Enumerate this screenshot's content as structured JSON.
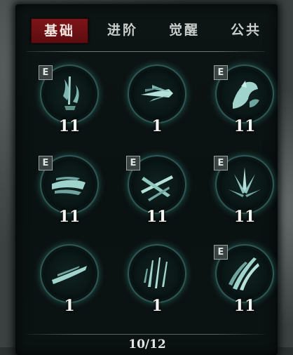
{
  "tabs": [
    {
      "label": "基础",
      "active": true
    },
    {
      "label": "进阶",
      "active": false
    },
    {
      "label": "觉醒",
      "active": false
    },
    {
      "label": "公共",
      "active": false
    }
  ],
  "skills": [
    {
      "icon": "sword-flame-icon",
      "level": "11",
      "equipped_badge": "E"
    },
    {
      "icon": "feather-arrow-icon",
      "level": "1",
      "equipped_badge": ""
    },
    {
      "icon": "shadow-strike-icon",
      "level": "11",
      "equipped_badge": "E"
    },
    {
      "icon": "slash-wave-icon",
      "level": "11",
      "equipped_badge": "E"
    },
    {
      "icon": "cross-blades-icon",
      "level": "11",
      "equipped_badge": "E"
    },
    {
      "icon": "burst-blades-icon",
      "level": "11",
      "equipped_badge": "E"
    },
    {
      "icon": "dash-slash-icon",
      "level": "1",
      "equipped_badge": ""
    },
    {
      "icon": "falling-blades-icon",
      "level": "1",
      "equipped_badge": ""
    },
    {
      "icon": "claw-rake-icon",
      "level": "11",
      "equipped_badge": "E"
    }
  ],
  "pager": {
    "text": "10/12"
  },
  "colors": {
    "active_tab": "#7d1418",
    "glow": "#40aaa0",
    "panel": "#0d1414"
  }
}
